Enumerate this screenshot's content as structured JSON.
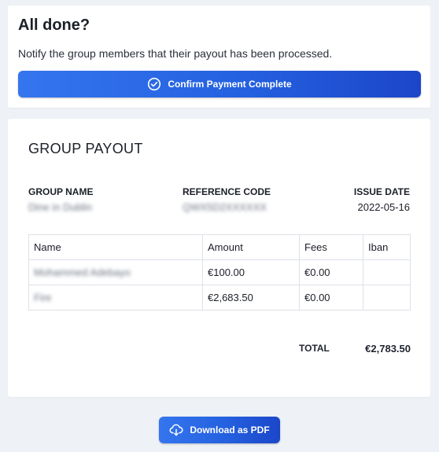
{
  "confirmation": {
    "title": "All done?",
    "description": "Notify the group members that their payout has been processed.",
    "confirm_button_label": "Confirm Payment Complete",
    "confirm_icon": "check-circle-icon"
  },
  "payout": {
    "title": "GROUP PAYOUT",
    "group_name_label": "GROUP NAME",
    "group_name_value": "Dine in Dublin",
    "reference_code_label": "REFERENCE CODE",
    "reference_code_value": "QWX5D2XXXXXX",
    "issue_date_label": "ISSUE DATE",
    "issue_date_value": "2022-05-16",
    "table": {
      "headers": [
        "Name",
        "Amount",
        "Fees",
        "Iban"
      ],
      "rows": [
        {
          "name": "Mohammed Adebayo",
          "amount": "€100.00",
          "fees": "€0.00",
          "iban": ""
        },
        {
          "name": "Fire",
          "amount": "€2,683.50",
          "fees": "€0.00",
          "iban": ""
        }
      ]
    },
    "total_label": "TOTAL",
    "total_value": "€2,783.50"
  },
  "download_button_label": "Download as PDF",
  "download_icon": "cloud-download-icon",
  "colors": {
    "page_background": "#eef2f7",
    "card_background": "#ffffff",
    "button_gradient_start": "#3575ee",
    "button_gradient_end": "#1c46c9",
    "border": "#dde1e7"
  }
}
